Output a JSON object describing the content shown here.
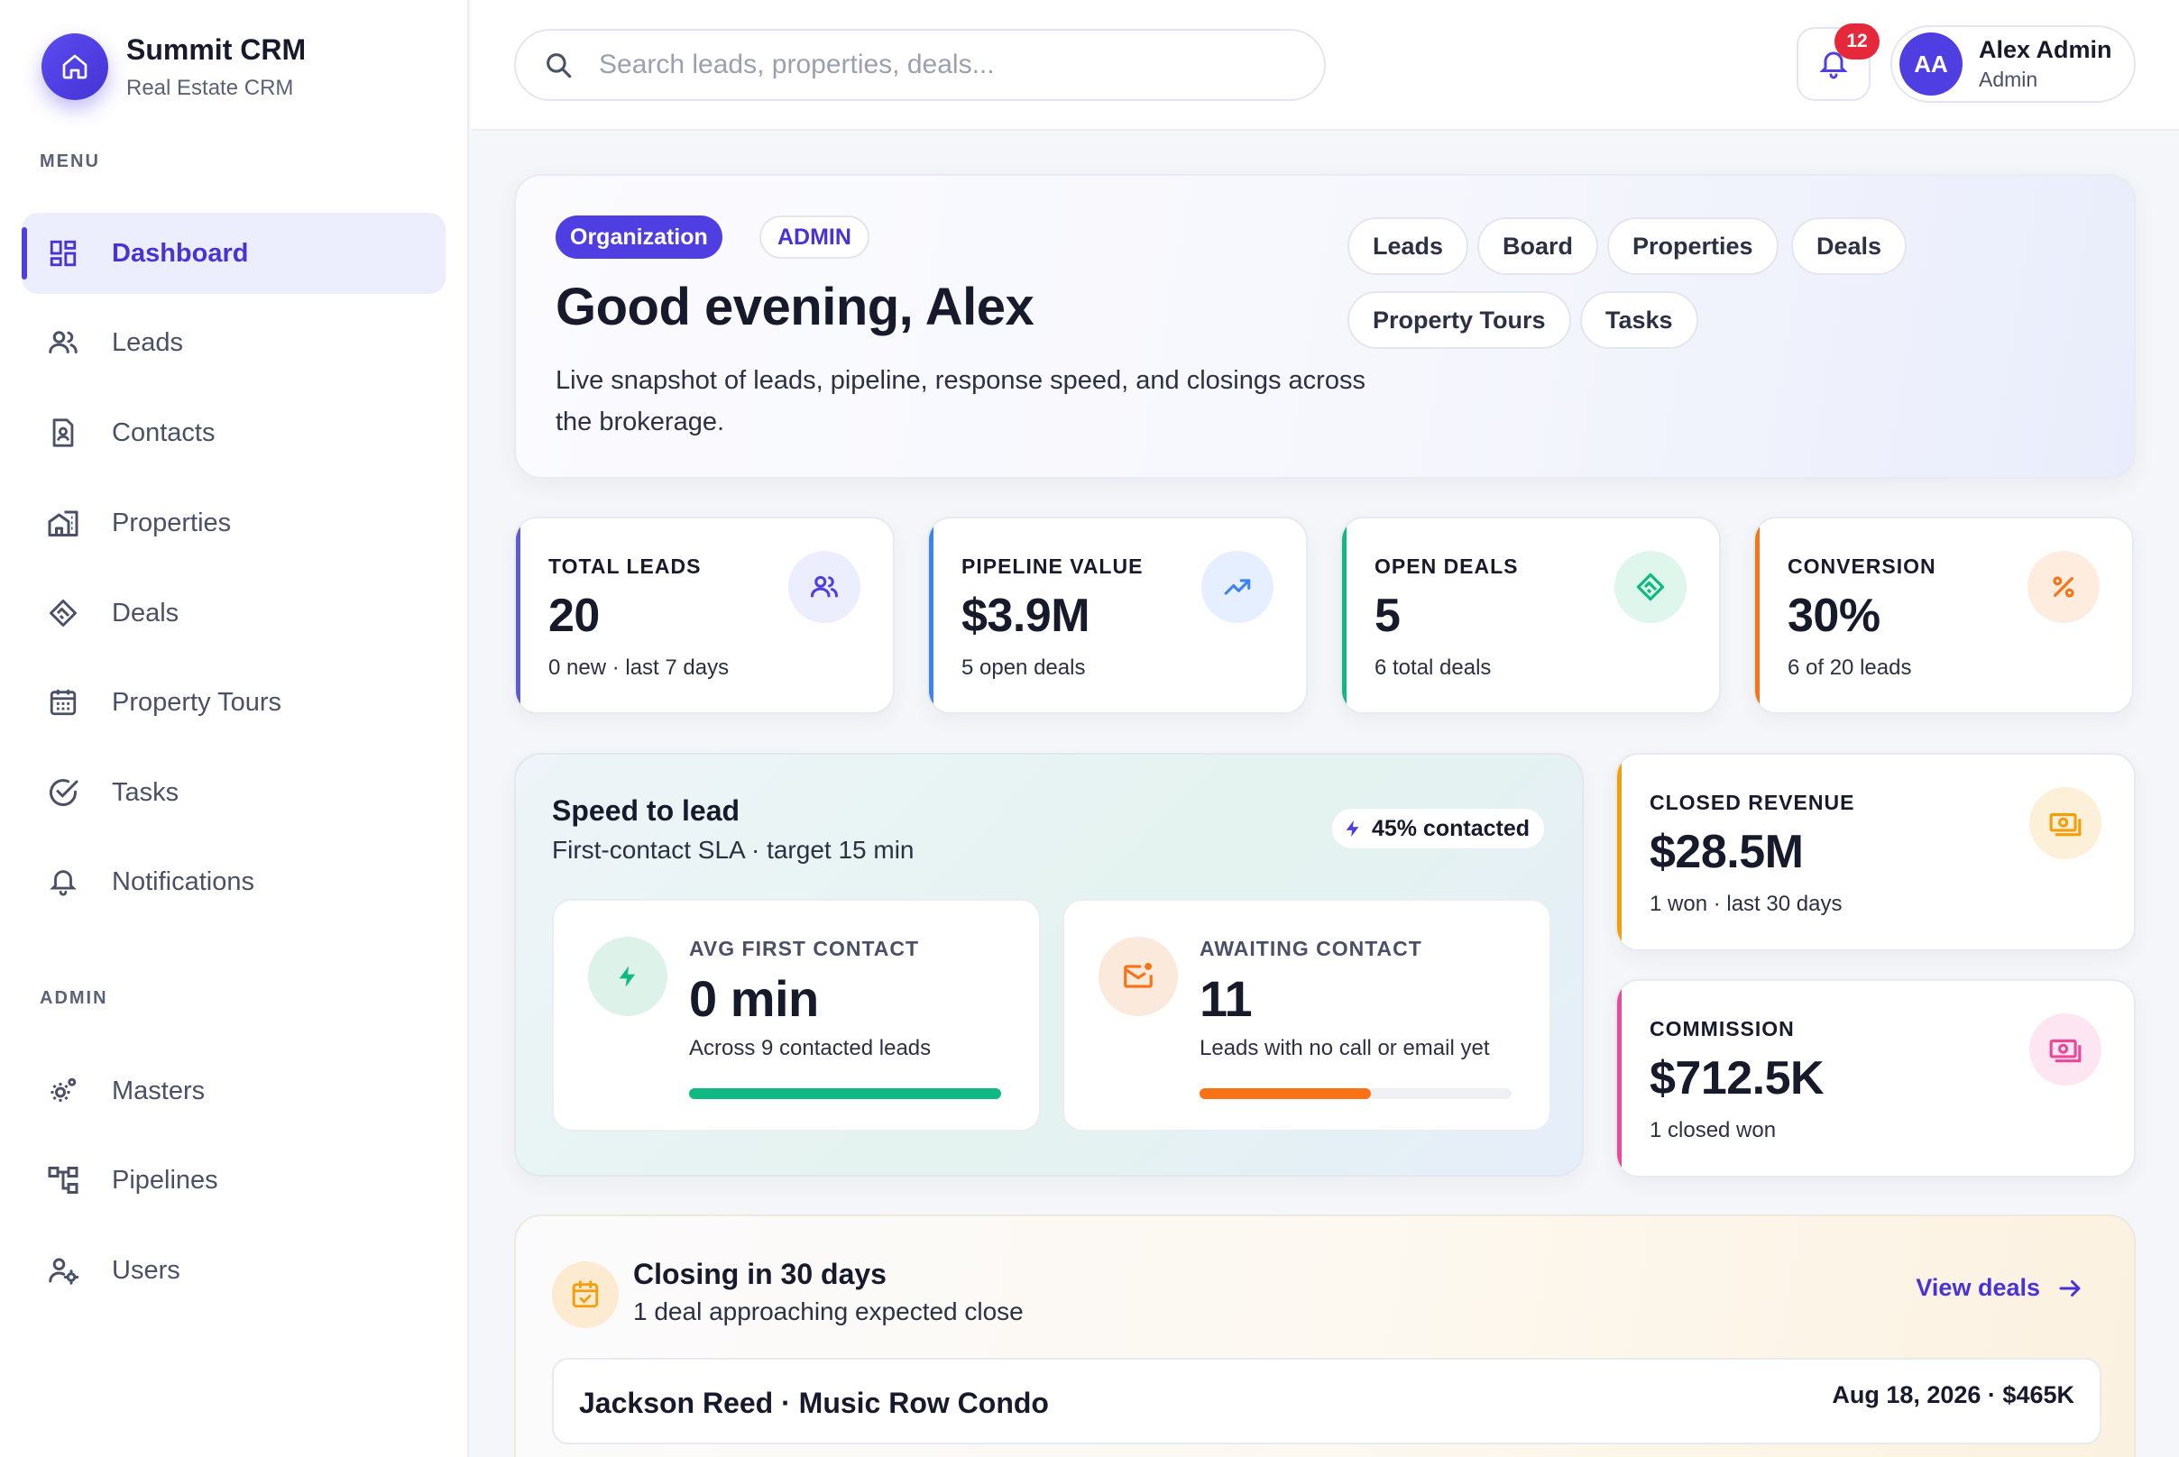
{
  "brand": {
    "name": "Summit CRM",
    "subtitle": "Real Estate CRM"
  },
  "sidebar": {
    "menu_heading": "MENU",
    "items": [
      {
        "label": "Dashboard",
        "icon": "dashboard-icon",
        "active": true
      },
      {
        "label": "Leads",
        "icon": "users-icon"
      },
      {
        "label": "Contacts",
        "icon": "contact-card-icon"
      },
      {
        "label": "Properties",
        "icon": "building-icon"
      },
      {
        "label": "Deals",
        "icon": "handshake-icon"
      },
      {
        "label": "Property Tours",
        "icon": "calendar-icon"
      },
      {
        "label": "Tasks",
        "icon": "check-circle-icon"
      },
      {
        "label": "Notifications",
        "icon": "bell-icon"
      }
    ],
    "admin_heading": "ADMIN",
    "admin_items": [
      {
        "label": "Masters",
        "icon": "gear-cluster-icon"
      },
      {
        "label": "Pipelines",
        "icon": "hierarchy-icon"
      },
      {
        "label": "Users",
        "icon": "user-settings-icon"
      }
    ]
  },
  "header": {
    "search_placeholder": "Search leads, properties, deals...",
    "notification_count": "12",
    "user": {
      "initials": "AA",
      "name": "Alex Admin",
      "role": "Admin"
    }
  },
  "hero": {
    "org_badge": "Organization",
    "role_badge": "ADMIN",
    "greeting": "Good evening, Alex",
    "subtitle": "Live snapshot of leads, pipeline, response speed, and closings across the brokerage.",
    "quick_links": [
      "Leads",
      "Board",
      "Properties",
      "Deals",
      "Property Tours",
      "Tasks"
    ]
  },
  "kpis": [
    {
      "label": "TOTAL LEADS",
      "value": "20",
      "foot": "0 new · last 7 days",
      "accent": "#5b5bd6",
      "icon": "users-icon"
    },
    {
      "label": "PIPELINE VALUE",
      "value": "$3.9M",
      "foot": "5 open deals",
      "accent": "#3b82f6",
      "icon": "trending-up-icon"
    },
    {
      "label": "OPEN DEALS",
      "value": "5",
      "foot": "6 total deals",
      "accent": "#10b981",
      "icon": "handshake-icon"
    },
    {
      "label": "CONVERSION",
      "value": "30%",
      "foot": "6 of 20 leads",
      "accent": "#f97316",
      "icon": "percent-icon"
    }
  ],
  "speed": {
    "title": "Speed to lead",
    "subtitle": "First-contact SLA · target 15 min",
    "badge": "45% contacted",
    "avg": {
      "label": "AVG FIRST CONTACT",
      "value": "0 min",
      "foot": "Across 9 contacted leads",
      "progress": 1.0,
      "color": "#10b981"
    },
    "awaiting": {
      "label": "AWAITING CONTACT",
      "value": "11",
      "foot": "Leads with no call or email yet",
      "progress": 0.55,
      "color": "#f97316"
    }
  },
  "side_cards": [
    {
      "label": "CLOSED REVENUE",
      "value": "$28.5M",
      "foot": "1 won · last 30 days",
      "accent": "#f59e0b",
      "icon": "cash-icon"
    },
    {
      "label": "COMMISSION",
      "value": "$712.5K",
      "foot": "1 closed won",
      "accent": "#ec4899",
      "icon": "cash-icon"
    }
  ],
  "closing": {
    "title": "Closing in 30 days",
    "subtitle": "1 deal approaching expected close",
    "link": "View deals",
    "deal": {
      "name": "Jackson Reed · Music Row Condo",
      "meta": "Aug 18, 2026 · $465K"
    }
  }
}
